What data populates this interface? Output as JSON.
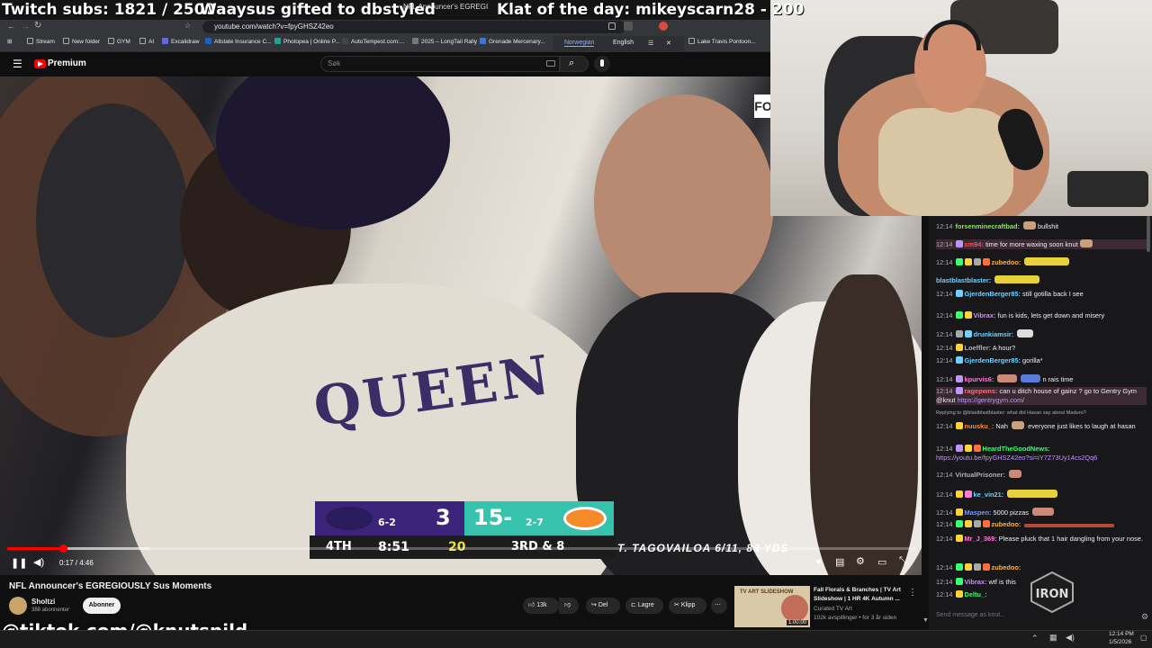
{
  "overlay": {
    "subs": "Twitch subs: 1821 / 2500",
    "gift": "Waaysus gifted to dbstyled",
    "klat": "Klat of the day: mikeyscarn28 - 200"
  },
  "browser": {
    "tab_title": "NFL Announcer's EGREGI",
    "url": "youtube.com/watch?v=fpyGHSZ42eo",
    "bookmarks": [
      "Stream",
      "New folder",
      "GYM",
      "AI",
      "Excalidraw",
      "Allstate Insurance C...",
      "Photopea | Online P...",
      "AutoTempest.com:...",
      "2025 – LongTail Rally",
      "Grenade Mercenary...",
      "Lake Travis Pontoon..."
    ],
    "translate": {
      "from": "Norwegian",
      "to": "English"
    }
  },
  "youtube": {
    "logo": "Premium",
    "search_placeholder": "Søk"
  },
  "video": {
    "jersey": "QUEEN",
    "network": "FO",
    "scorebug": {
      "away_record": "6-2",
      "away_score": "3",
      "home_score": "15-",
      "home_record": "2-7",
      "quarter": "4TH",
      "clock": "8:51",
      "play_clock": "20",
      "down": "3RD & 8",
      "ticker": "T. TAGOVAILOA 6/11, 88 YDS"
    },
    "time": "0:17 / 4:46",
    "progress_fraction": 0.061
  },
  "meta": {
    "title": "NFL Announcer's EGREGIOUSLY Sus Moments",
    "channel": "Sholtzi",
    "subscribers": "388 abonnenter",
    "subscribe": "Abonner",
    "likes": "13k",
    "share": "Del",
    "save": "Lagre",
    "clip": "Klipp"
  },
  "recommendation": {
    "title1": "Fall Florals & Branches | TV Art",
    "title2": "Slideshow | 1 HR 4K Autumn ...",
    "channel": "Curated TV Art",
    "stats": "102k avspillinger • for 3 år siden",
    "duration": "1:00:00",
    "thumb_text": "TV ART SLIDESHOW"
  },
  "tiktok": "@tiktok.com/@knutspild",
  "chat": {
    "messages": [
      {
        "time": "12:14",
        "user": "forsenminecraftbad:",
        "color": "#8fe36b",
        "text": "bullshit"
      },
      {
        "time": "12:14",
        "user": "xm94:",
        "color": "#ff4f4f",
        "text": "time for more waxing soon knut"
      },
      {
        "time": "12:14",
        "user": "zubedoo:",
        "color": "#ffb23a",
        "text": ""
      },
      {
        "time": "12:14",
        "user": "blastblastblaster:",
        "color": "#6fd1ff",
        "text": ""
      },
      {
        "time": "12:14",
        "user": "GjerdenBerger85:",
        "color": "#6fd1ff",
        "text": "still gotilla back I see"
      },
      {
        "time": "12:14",
        "user": "Vibrax:",
        "color": "#c792ff",
        "text": "fun is kids, lets get down and misery"
      },
      {
        "time": "12:14",
        "user": "drunkiamsir:",
        "color": "#6fd1ff",
        "text": ""
      },
      {
        "time": "12:14",
        "user": "Loeffler:",
        "color": "#adadb8",
        "text": "A hour?"
      },
      {
        "time": "12:14",
        "user": "GjerdenBerger85:",
        "color": "#6fd1ff",
        "text": "gorilla*"
      },
      {
        "time": "12:14",
        "user": "kpurvis6:",
        "color": "#ff7ad9",
        "text": "n rais time"
      },
      {
        "time": "12:14",
        "user": "ragepwns:",
        "color": "#ff6e6e",
        "text": "can u ditch house of gainz ? go to Gentry Gym @knut ",
        "link": "https://gentrygym.com/"
      },
      {
        "reply": "Replying to @blastblastblaster: what did Hasan say about Maduro?"
      },
      {
        "time": "12:14",
        "user": "nuusku_:",
        "color": "#ff8c3a",
        "text": "Nah",
        "text2": "everyone just likes to laugh at hasan"
      },
      {
        "time": "12:14",
        "user": "HeardTheGoodNews:",
        "color": "#3aff6e",
        "text": "",
        "link": "https://youtu.be/fpyGHSZ42eo?si=iY7Z73Uy14cs2Qq6"
      },
      {
        "time": "12:14",
        "user": "VirtualPrisoner:",
        "color": "#adadb8",
        "text": ""
      },
      {
        "time": "12:14",
        "user": "ke_vin21:",
        "color": "#6fd1ff",
        "text": ""
      },
      {
        "time": "12:14",
        "user": "Maspen:",
        "color": "#6f9bff",
        "text": "5000 pizzas"
      },
      {
        "time": "12:14",
        "user": "zubedoo:",
        "color": "#ffb23a",
        "text": ""
      },
      {
        "time": "12:14",
        "user": "Mr_J_369:",
        "color": "#ff7ad9",
        "text": "Please pluck that 1 hair dangling from your nose."
      },
      {
        "time": "12:14",
        "user": "zubedoo:",
        "color": "#ffb23a",
        "text": ""
      },
      {
        "time": "12:14",
        "user": "Vibrax:",
        "color": "#c792ff",
        "text": "wtf is this"
      },
      {
        "time": "12:14",
        "user": "Deltu_:",
        "color": "#3aff6e",
        "text": ""
      }
    ],
    "input_placeholder": "Send message as knut...",
    "logo": "IRON"
  },
  "taskbar": {
    "clock": "12:14 PM",
    "date": "1/5/2026"
  }
}
